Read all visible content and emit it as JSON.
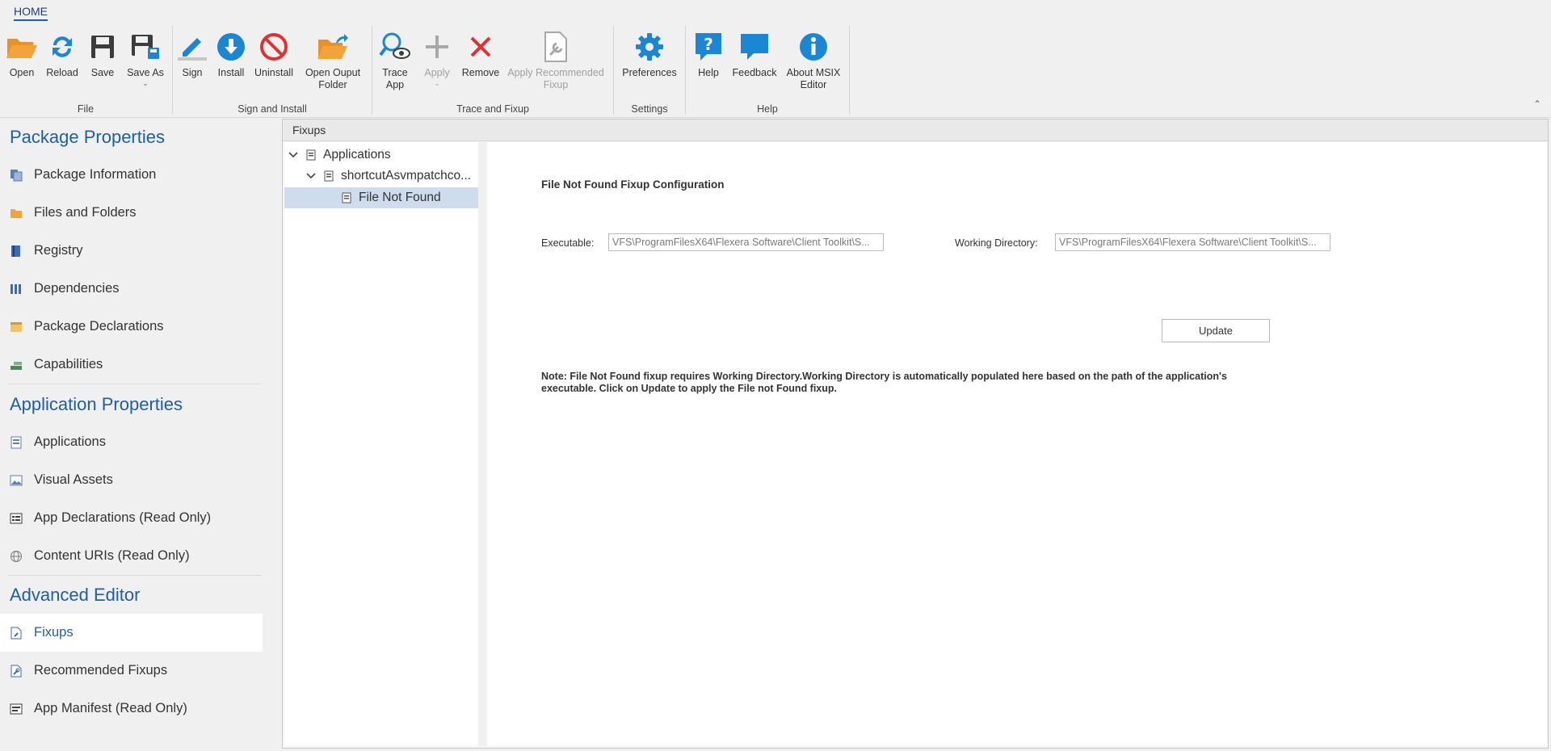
{
  "ribbon": {
    "tab": "HOME",
    "groups": {
      "file": "File",
      "sign_install": "Sign and Install",
      "trace_fixup": "Trace and Fixup",
      "settings": "Settings",
      "help": "Help"
    },
    "buttons": {
      "open": "Open",
      "reload": "Reload",
      "save": "Save",
      "save_as": "Save As",
      "sign": "Sign",
      "install": "Install",
      "uninstall": "Uninstall",
      "open_output": "Open Ouput\nFolder",
      "trace_app": "Trace\nApp",
      "apply": "Apply",
      "remove": "Remove",
      "apply_recommended": "Apply Recommended\nFixup",
      "preferences": "Preferences",
      "help": "Help",
      "feedback": "Feedback",
      "about": "About MSIX\nEditor"
    },
    "colors": {
      "accent": "#1f5ea8",
      "orange": "#f2a33a",
      "blue": "#1b86d4",
      "red": "#e03030"
    }
  },
  "sidebar": {
    "package_properties": {
      "title": "Package Properties",
      "items": [
        "Package Information",
        "Files and Folders",
        "Registry",
        "Dependencies",
        "Package Declarations",
        "Capabilities"
      ]
    },
    "application_properties": {
      "title": "Application Properties",
      "items": [
        "Applications",
        "Visual Assets",
        "App Declarations (Read Only)",
        "Content URIs (Read Only)"
      ]
    },
    "advanced_editor": {
      "title": "Advanced Editor",
      "items": [
        "Fixups",
        "Recommended Fixups",
        "App Manifest (Read Only)"
      ],
      "active": "Fixups"
    }
  },
  "content": {
    "header": "Fixups",
    "tree": {
      "root": "Applications",
      "child": "shortcutAsvmpatchco...",
      "leaf": "File Not Found"
    },
    "detail": {
      "title": "File Not Found Fixup Configuration",
      "executable_label": "Executable:",
      "executable_value": "VFS\\ProgramFilesX64\\Flexera Software\\Client Toolkit\\S...",
      "working_dir_label": "Working Directory:",
      "working_dir_value": "VFS\\ProgramFilesX64\\Flexera Software\\Client Toolkit\\S...",
      "update_button": "Update",
      "note": "Note: File Not Found fixup requires Working Directory.Working Directory is automatically populated here based on the path of the application's executable. Click on Update to apply the File not Found fixup."
    }
  }
}
